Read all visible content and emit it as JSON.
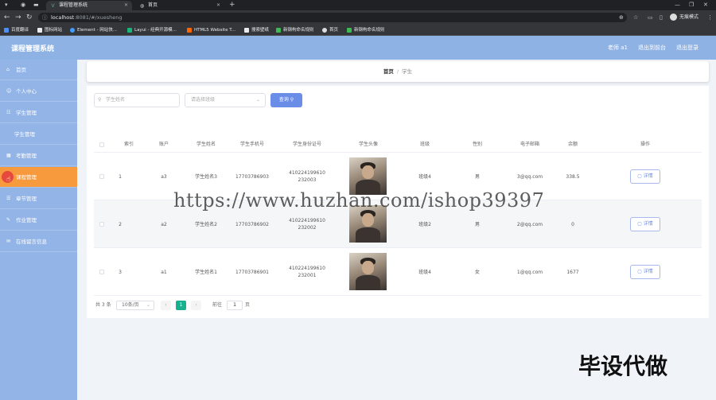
{
  "browser": {
    "tabs": [
      {
        "title": "课程管理系统",
        "icon": "v-logo-icon",
        "active": true
      },
      {
        "title": "首页",
        "icon": "globe-icon",
        "active": false
      }
    ],
    "url_host": "localhost",
    "url_path": ":8081/#/xuesheng",
    "profile": "无痕模式",
    "bookmarks": [
      {
        "label": "百度翻译",
        "color": "#4e8ef7"
      },
      {
        "label": "图标网站",
        "color": "#333333"
      },
      {
        "label": "Element - 网站快...",
        "color": "#409eff"
      },
      {
        "label": "Layui - 经典开源模...",
        "color": "#16b777"
      },
      {
        "label": "HTML5 Website T...",
        "color": "#ff6600"
      },
      {
        "label": "搜索壁纸",
        "color": "#e8eaed"
      },
      {
        "label": "新钢构命名规则",
        "color": "#3cba54"
      },
      {
        "label": "首页",
        "color": "#dddddd"
      },
      {
        "label": "新钢构命名规则",
        "color": "#3cba54"
      }
    ]
  },
  "header": {
    "title": "课程管理系统",
    "user": "老师 a1",
    "back_label": "退出到前台",
    "logout_label": "退出登录"
  },
  "sidebar": {
    "items": [
      {
        "label": "首页",
        "icon": "home-icon"
      },
      {
        "label": "个人中心",
        "icon": "user-icon"
      },
      {
        "label": "学生管理",
        "icon": "users-icon"
      },
      {
        "label": "学生管理",
        "icon": ""
      },
      {
        "label": "考勤管理",
        "icon": "calendar-icon"
      },
      {
        "label": "课程管理",
        "icon": "book-icon"
      },
      {
        "label": "章节管理",
        "icon": "list-icon"
      },
      {
        "label": "作业管理",
        "icon": "edit-icon"
      },
      {
        "label": "在线留言信息",
        "icon": "message-icon"
      }
    ]
  },
  "breadcrumb": {
    "home": "首页",
    "separator": "/",
    "current": "学生"
  },
  "search": {
    "name_placeholder": "学生姓名",
    "class_placeholder": "请选择班级",
    "query_label": "查询"
  },
  "table": {
    "headers": [
      "索引",
      "账户",
      "学生姓名",
      "学生手机号",
      "学生身份证号",
      "学生头像",
      "班级",
      "性别",
      "电子邮箱",
      "余额",
      "操作"
    ],
    "rows": [
      {
        "index": "1",
        "account": "a3",
        "name": "学生姓名3",
        "phone": "17703786903",
        "id_line1": "410224199610",
        "id_line2": "232003",
        "class": "班级4",
        "gender": "男",
        "email": "3@qq.com",
        "balance": "338.5",
        "action": "详情"
      },
      {
        "index": "2",
        "account": "a2",
        "name": "学生姓名2",
        "phone": "17703786902",
        "id_line1": "410224199610",
        "id_line2": "232002",
        "class": "班级2",
        "gender": "男",
        "email": "2@qq.com",
        "balance": "0",
        "action": "详情"
      },
      {
        "index": "3",
        "account": "a1",
        "name": "学生姓名1",
        "phone": "17703786901",
        "id_line1": "410224199610",
        "id_line2": "232001",
        "class": "班级4",
        "gender": "女",
        "email": "1@qq.com",
        "balance": "1677",
        "action": "详情"
      }
    ]
  },
  "pagination": {
    "total": "共 3 条",
    "page_size": "10条/页",
    "prev": "‹",
    "current": "1",
    "next": "›",
    "goto_label": "前往",
    "goto_value": "1",
    "page_unit": "页"
  },
  "watermark": "https://www.huzhan.com/ishop39397",
  "overlay_text": "毕设代做",
  "colors": {
    "header": "#8fb2e4",
    "sidebar": "#93b4e6",
    "active_menu": "#f79a3e",
    "primary": "#6a8de8",
    "pager_active": "#18b08f"
  }
}
